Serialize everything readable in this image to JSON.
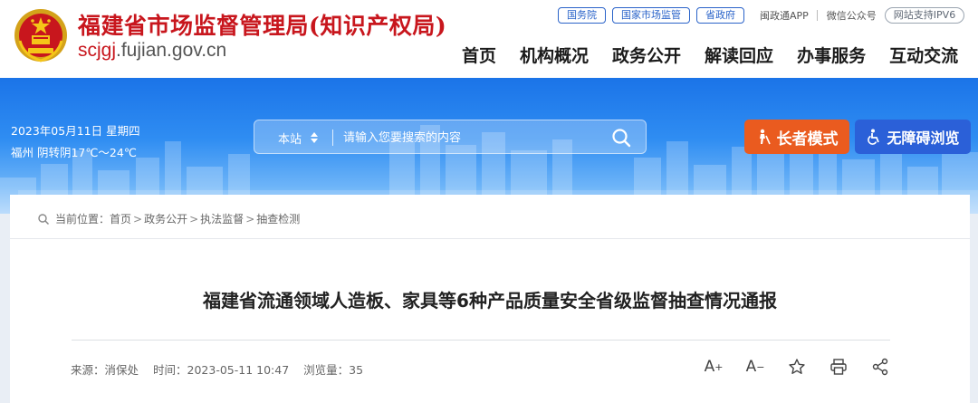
{
  "header": {
    "title": "福建省市场监督管理局(知识产权局)",
    "domain_prefix": "scjgj",
    "domain_suffix": ".fujian.gov.cn",
    "emblem": "national-emblem-icon",
    "top_links": {
      "guowuyuan": "国务院",
      "samr": "国家市场监管",
      "provincial_gov": "省政府",
      "mintong_app": "闽政通APP",
      "wechat": "微信公众号",
      "ipv6": "网站支持IPV6"
    },
    "nav": [
      "首页",
      "机构概况",
      "政务公开",
      "解读回应",
      "办事服务",
      "互动交流"
    ]
  },
  "banner": {
    "date": "2023年05月11日 星期四",
    "weather": "福州 阴转阴17℃～24℃",
    "search": {
      "scope": "本站",
      "placeholder": "请输入您要搜索的内容"
    },
    "elder_mode": "长者模式",
    "accessibility": "无障碍浏览"
  },
  "breadcrumb": {
    "prefix": "当前位置：",
    "items": [
      "首页",
      "政务公开",
      "执法监督",
      "抽查检测"
    ]
  },
  "article": {
    "title": "福建省流通领域人造板、家具等6种产品质量安全省级监督抽查情况通报",
    "source": "来源：消保处",
    "time": "时间：2023-05-11 10:47",
    "views": "浏览量：35"
  },
  "tools": {
    "font_increase": "A",
    "font_decrease": "A"
  },
  "colors": {
    "brand_red": "#c8161d",
    "nav_blue": "#2a63c9",
    "elder_orange": "#ea5b1f",
    "access_blue": "#2b60d8"
  }
}
